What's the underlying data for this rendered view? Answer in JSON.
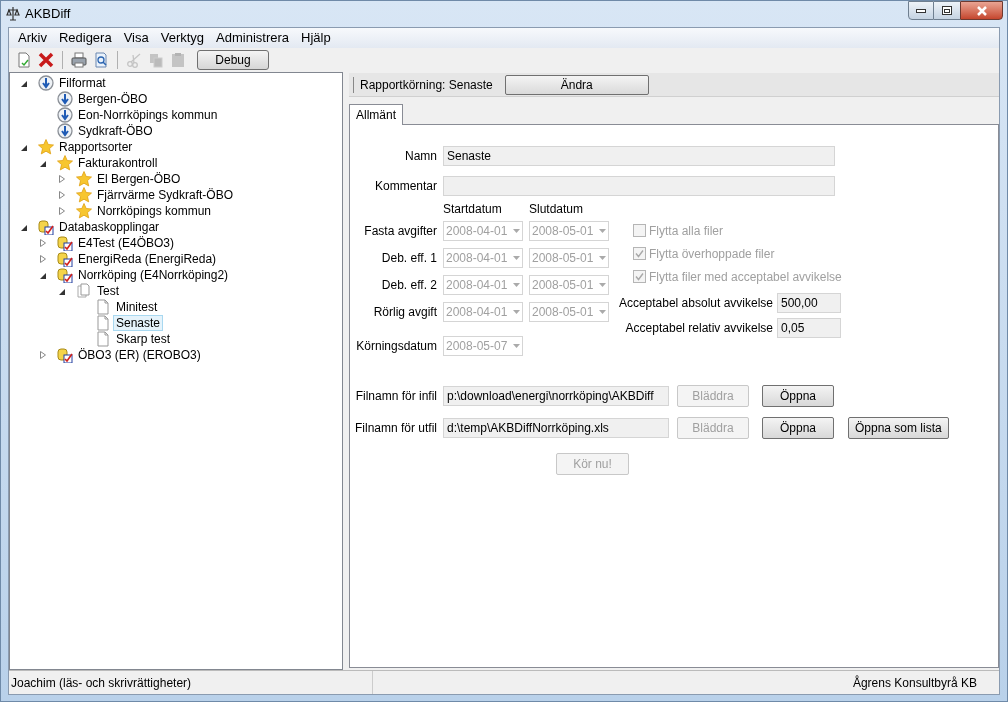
{
  "window": {
    "title": "AKBDiff"
  },
  "menu": [
    "Arkiv",
    "Redigera",
    "Visa",
    "Verktyg",
    "Administrera",
    "Hjälp"
  ],
  "toolbar": [
    {
      "kind": "new",
      "disabled": false
    },
    {
      "kind": "delete",
      "disabled": false
    },
    {
      "kind": "separator"
    },
    {
      "kind": "print",
      "disabled": false
    },
    {
      "kind": "preview",
      "disabled": false
    },
    {
      "kind": "separator"
    },
    {
      "kind": "cut",
      "disabled": true
    },
    {
      "kind": "copy",
      "disabled": true
    },
    {
      "kind": "paste",
      "disabled": true
    },
    {
      "kind": "button",
      "label": "Debug"
    }
  ],
  "tree": [
    {
      "label": "Filformat",
      "kind": "format",
      "expanded": true,
      "selected": false,
      "children": [
        {
          "label": "Bergen-ÖBO",
          "kind": "format",
          "selected": false
        },
        {
          "label": "Eon-Norrköpings kommun",
          "kind": "format",
          "selected": false
        },
        {
          "label": "Sydkraft-ÖBO",
          "kind": "format",
          "selected": false
        }
      ]
    },
    {
      "label": "Rapportsorter",
      "kind": "star",
      "expanded": true,
      "selected": false,
      "children": [
        {
          "label": "Fakturakontroll",
          "kind": "star",
          "expanded": true,
          "selected": false,
          "children": [
            {
              "label": "El Bergen-ÖBO",
              "kind": "star",
              "expanded": false,
              "selected": false
            },
            {
              "label": "Fjärrvärme Sydkraft-ÖBO",
              "kind": "star",
              "expanded": false,
              "selected": false
            },
            {
              "label": "Norrköpings kommun",
              "kind": "star",
              "expanded": false,
              "selected": false
            }
          ]
        }
      ]
    },
    {
      "label": "Databaskopplingar",
      "kind": "database",
      "expanded": true,
      "selected": false,
      "children": [
        {
          "label": "E4Test (E4ÖBO3)",
          "kind": "database",
          "expanded": false,
          "selected": false
        },
        {
          "label": "EnergiReda (EnergiReda)",
          "kind": "database",
          "expanded": false,
          "selected": false
        },
        {
          "label": "Norrköping (E4Norrköping2)",
          "kind": "database",
          "expanded": true,
          "selected": false,
          "children": [
            {
              "label": "Test",
              "kind": "folder",
              "expanded": true,
              "selected": false,
              "children": [
                {
                  "label": "Minitest",
                  "kind": "document",
                  "selected": false
                },
                {
                  "label": "Senaste",
                  "kind": "document",
                  "selected": true
                },
                {
                  "label": "Skarp test",
                  "kind": "document",
                  "selected": false
                }
              ]
            }
          ]
        },
        {
          "label": "ÖBO3 (ER) (EROBO3)",
          "kind": "database",
          "expanded": false,
          "selected": false
        }
      ]
    }
  ],
  "header": {
    "label": "Rapportkörning: Senaste",
    "button": "Ändra"
  },
  "tabs": [
    {
      "label": "Allmänt",
      "selected": true
    }
  ],
  "form": {
    "name": {
      "label": "Namn",
      "value": "Senaste"
    },
    "comment": {
      "label": "Kommentar"
    },
    "date_headers": [
      "Startdatum",
      "Slutdatum"
    ],
    "date_rows": [
      {
        "label": "Fasta avgifter",
        "start": "2008-04-01",
        "end": "2008-05-01",
        "disabled": true
      },
      {
        "label": "Deb. eff. 1",
        "start": "2008-04-01",
        "end": "2008-05-01",
        "disabled": true
      },
      {
        "label": "Deb. eff. 2",
        "start": "2008-04-01",
        "end": "2008-05-01",
        "disabled": true
      },
      {
        "label": "Rörlig avgift",
        "start": "2008-04-01",
        "end": "2008-05-01",
        "disabled": true
      }
    ],
    "run_date": {
      "label": "Körningsdatum",
      "value": "2008-05-07",
      "disabled": true
    },
    "checkboxes": [
      {
        "label": "Flytta alla filer",
        "checked": false,
        "disabled": true
      },
      {
        "label": "Flytta överhoppade filer",
        "checked": true,
        "disabled": true
      },
      {
        "label": "Flytta filer med acceptabel avvikelse",
        "checked": true,
        "disabled": true
      }
    ],
    "thresholds": [
      {
        "label": "Acceptabel absolut avvikelse",
        "value": "500,00"
      },
      {
        "label": "Acceptabel relativ avvikelse",
        "value": "0,05"
      }
    ],
    "files": [
      {
        "label": "Filnamn för infil",
        "value": "p:\\download\\energi\\norrköping\\AKBDiff",
        "browse": {
          "label": "Bläddra",
          "disabled": true
        },
        "buttons": [
          "Öppna"
        ]
      },
      {
        "label": "Filnamn för utfil",
        "value": "d:\\temp\\AKBDiffNorrköping.xls",
        "browse": {
          "label": "Bläddra",
          "disabled": true
        },
        "buttons": [
          "Öppna",
          "Öppna som lista"
        ]
      }
    ],
    "run_button": {
      "label": "Kör nu!",
      "disabled": true
    }
  },
  "status_bar": {
    "left": "Joachim (läs- och skrivrättigheter)",
    "right": "Ågrens Konsultbyrå KB"
  }
}
